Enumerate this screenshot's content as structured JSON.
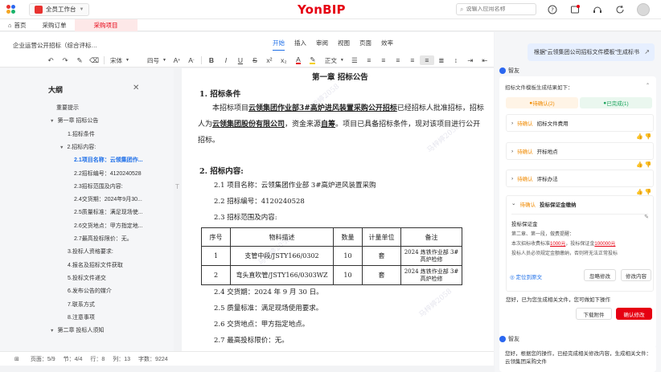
{
  "app": {
    "brand": "YonBIP",
    "workspace": "全员工作台",
    "search_placeholder": "说输入应用名称",
    "icons": [
      "apps-icon",
      "help-icon",
      "notification-icon",
      "headset-icon",
      "refresh-icon",
      "avatar"
    ]
  },
  "tabs": [
    {
      "label": "首页",
      "icon": "home-icon"
    },
    {
      "label": "采购订单"
    },
    {
      "label": "采购项目",
      "active": true
    }
  ],
  "doc_header": {
    "title": "企业运营公开招标（综合评标…",
    "menu": [
      "开始",
      "插入",
      "审阅",
      "视图",
      "页面",
      "效率"
    ],
    "active_menu": "开始",
    "font": "宋体",
    "size": "四号",
    "style": "正文"
  },
  "outline": {
    "title": "大纲",
    "items": [
      {
        "label": "重要提示",
        "level": 0
      },
      {
        "label": "第一章 招标公告",
        "level": 0,
        "expanded": true
      },
      {
        "label": "1.招标条件",
        "level": 1
      },
      {
        "label": "2.招标内容:",
        "level": 1,
        "expanded": true
      },
      {
        "label": "2.1项目名称：云领集团作...",
        "level": 2,
        "active": true
      },
      {
        "label": "2.2招标编号：4120240528",
        "level": 2
      },
      {
        "label": "2.3招标范围及内容:",
        "level": 2
      },
      {
        "label": "2.4交货期：2024年9月30...",
        "level": 2
      },
      {
        "label": "2.5质量标准：满足现场使...",
        "level": 2
      },
      {
        "label": "2.6交货地点：甲方指定地...",
        "level": 2
      },
      {
        "label": "2.7最高投标限价：无。",
        "level": 2
      },
      {
        "label": "3.投标人资格要求:",
        "level": 1
      },
      {
        "label": "4.报名及招标文件获取",
        "level": 1
      },
      {
        "label": "5.投标文件递交",
        "level": 1
      },
      {
        "label": "6.发布公告的媒介",
        "level": 1
      },
      {
        "label": "7.联系方式",
        "level": 1
      },
      {
        "label": "8.注意事项",
        "level": 1
      },
      {
        "label": "第二章 投标人须知",
        "level": 0
      }
    ]
  },
  "document": {
    "chapter_title": "第一章 招标公告",
    "section1_title": "1. 招标条件",
    "para1_a": "本招标项目",
    "para1_project": "云领集团作业部3#高炉进风装置采购公开招标",
    "para1_b": "已经招标人批准招标，招标人为",
    "para1_company": "云领集团股份有限公司",
    "para1_c": "，资金来源",
    "para1_fund": "自筹",
    "para1_d": "。项目已具备招标条件，现对该项目进行公开招标。",
    "section2_title": "2. 招标内容:",
    "items": [
      "2.1 项目名称：云领集团作业部 3#高炉进风装置采购",
      "2.2 招标编号：4120240528",
      "2.3 招标范围及内容:"
    ],
    "table": {
      "headers": [
        "序号",
        "物料描述",
        "数量",
        "计量单位",
        "备注"
      ],
      "rows": [
        [
          "1",
          "支管中段/JSTY166/0302",
          "10",
          "套",
          "2024 炼铁作业部 3#高炉检修"
        ],
        [
          "2",
          "弯头直吹管/JSTY166/0303WZ",
          "10",
          "套",
          "2024 炼铁作业部 3#高炉检修"
        ]
      ]
    },
    "items_after": [
      "2.4 交货期：2024 年 9 月 30 日。",
      "2.5 质量标准：满足现场使用要求。",
      "2.6 交货地点：甲方指定地点。",
      "2.7 最高投标限价：无。"
    ],
    "watermark": "马梓婷2058"
  },
  "status": {
    "page": "页面：5/9",
    "section": "节：4/4",
    "line": "行：8",
    "col": "列：13",
    "words": "字数：9224"
  },
  "panel": {
    "user_bubble": "根据\"云领集团公司招标文件模板\"生成标书",
    "ai_name": "智友",
    "result_header": "招标文件模板生成结果如下：",
    "pending_tab": "待确认(2)",
    "done_tab": "已完成(1)",
    "pending_tag": "待确认",
    "rows": [
      "招标文件费用",
      "开标地点",
      "评标办法",
      "投标保证金缴纳"
    ],
    "guarantee": {
      "title": "投标保证金",
      "line1": "第二章、第一段，做费提醒：",
      "line2_a": "本次招标收费标准",
      "amount1": "1000元",
      "line2_b": "，投标保证金",
      "amount2": "100000元",
      "line3": "投标人员必须规定金额缴纳，否则将无法正常投标"
    },
    "locate_btn": "定位到原文",
    "ignore_btn": "忽略修改",
    "modify_btn": "修改内容",
    "confirm_text": "您好，已为您生成相关文件，您可做如下操作",
    "download_btn": "下载附件",
    "confirm_btn": "确认修改",
    "ai_name2": "智友",
    "final_text": "您好，根据您的操作，已经完成相关修改内容，生成相关文件：云领集团采购文件"
  }
}
